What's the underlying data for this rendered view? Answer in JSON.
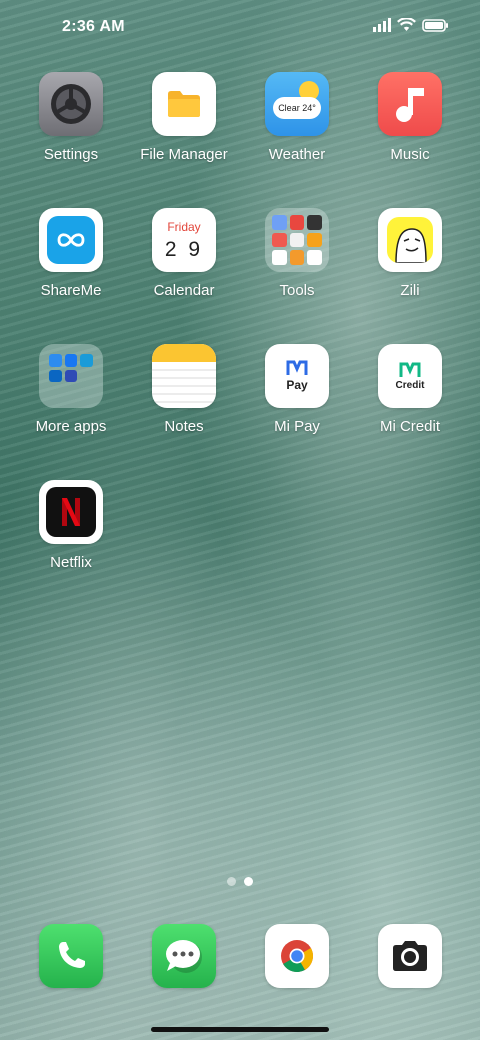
{
  "status_bar": {
    "time": "2:36 AM"
  },
  "apps": [
    {
      "label": "Settings"
    },
    {
      "label": "File Manager"
    },
    {
      "label": "Weather",
      "badge_text": "Clear 24°"
    },
    {
      "label": "Music"
    },
    {
      "label": "ShareMe"
    },
    {
      "label": "Calendar",
      "day_name": "Friday",
      "date": "2 9"
    },
    {
      "label": "Tools"
    },
    {
      "label": "Zili"
    },
    {
      "label": "More apps"
    },
    {
      "label": "Notes"
    },
    {
      "label": "Mi Pay",
      "text": "Pay"
    },
    {
      "label": "Mi Credit",
      "text": "Credit"
    },
    {
      "label": "Netflix"
    }
  ],
  "dock": [
    "phone-icon",
    "messages-icon",
    "chrome-icon",
    "camera-icon"
  ],
  "colors": {
    "music": "#f5605a",
    "shareme": "#1aa3e8",
    "weather": "#3fa8f0",
    "phone": "#34c759",
    "mipay": "#2d6be5",
    "micredit": "#12b886",
    "netflix": "#e50914"
  }
}
